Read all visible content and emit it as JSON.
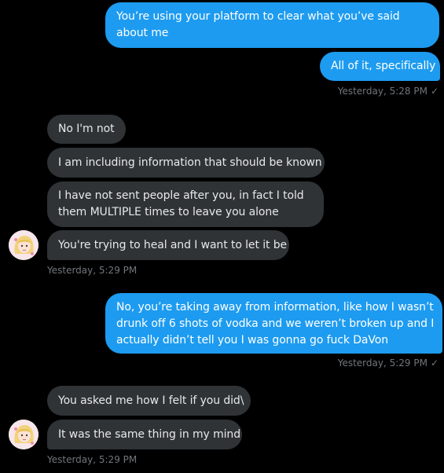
{
  "conversation": {
    "messages": [
      {
        "id": "m1",
        "dir": "sent",
        "text": "You’re using your platform to clear what you’ve said about me"
      },
      {
        "id": "m2",
        "dir": "sent",
        "text": "All of it, specifically"
      },
      {
        "id": "m3",
        "dir": "recv",
        "text": "No I'm not"
      },
      {
        "id": "m4",
        "dir": "recv",
        "text": "I am including information that should be known"
      },
      {
        "id": "m5",
        "dir": "recv",
        "text": "I have not sent people after you, in fact I told them MULTIPLE times to leave you alone"
      },
      {
        "id": "m6",
        "dir": "recv",
        "text": "You're trying to heal and I want to let it be"
      },
      {
        "id": "m7",
        "dir": "sent",
        "text": "No, you’re taking away from information, like how I wasn’t drunk off 6 shots of vodka and we weren’t broken up and I actually didn’t tell you I was gonna go fuck DaVon"
      },
      {
        "id": "m8",
        "dir": "recv",
        "text": "You asked me how I felt if you did\\"
      },
      {
        "id": "m9",
        "dir": "recv",
        "text": "It was the same thing in my mind"
      }
    ],
    "timestamps": {
      "t1": "Yesterday, 5:28 PM",
      "t2": "Yesterday, 5:29 PM",
      "t3": "Yesterday, 5:29 PM",
      "t4": "Yesterday, 5:29 PM"
    },
    "read_mark": "✓",
    "colors": {
      "background": "#000000",
      "sent_bubble": "#1d9bf0",
      "received_bubble": "#2f3336",
      "meta_text": "#71767b"
    },
    "icons": {
      "avatar": "avatar-illustration",
      "read_receipt": "check-icon"
    }
  }
}
